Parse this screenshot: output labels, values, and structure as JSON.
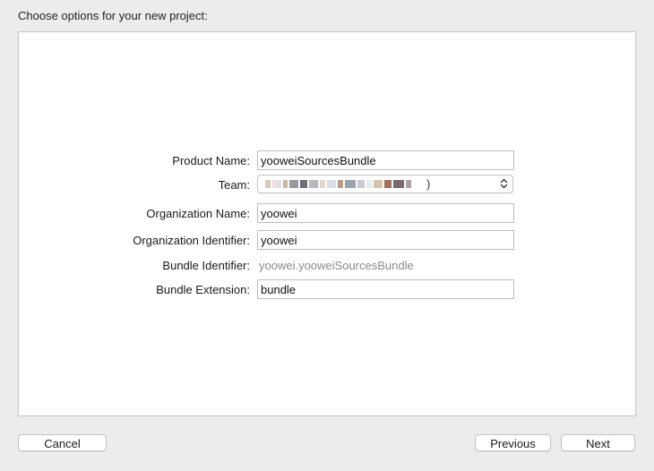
{
  "dialog": {
    "title": "Choose options for your new project:"
  },
  "form": {
    "product_name": {
      "label": "Product Name:",
      "value": "yooweiSourcesBundle"
    },
    "team": {
      "label": "Team:",
      "value_suffix": ")"
    },
    "organization_name": {
      "label": "Organization Name:",
      "value": "yoowei"
    },
    "organization_identifier": {
      "label": "Organization Identifier:",
      "value": "yoowei"
    },
    "bundle_identifier": {
      "label": "Bundle Identifier:",
      "value": "yoowei.yooweiSourcesBundle"
    },
    "bundle_extension": {
      "label": "Bundle Extension:",
      "value": "bundle"
    }
  },
  "buttons": {
    "cancel": "Cancel",
    "previous": "Previous",
    "next": "Next"
  },
  "icons": {
    "team_popup": "chevron-up-down-icon"
  }
}
